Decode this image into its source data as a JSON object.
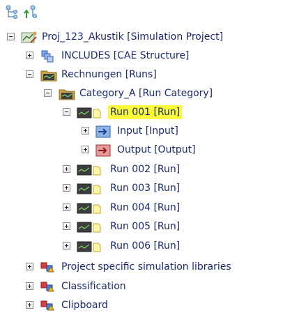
{
  "toolbar": {
    "icons": [
      "hierarchy-icon",
      "hierarchy-up-icon"
    ]
  },
  "colors": {
    "selection": "#fbfb3a",
    "text": "#1a2a73"
  },
  "tree": {
    "project": {
      "label": "Proj_123_Akustik [Simulation Project]",
      "expanded": true
    },
    "includes": {
      "label": "INCLUDES [CAE Structure]",
      "expanded": false
    },
    "rechnungen": {
      "label": "Rechnungen [Runs]",
      "expanded": true
    },
    "category_a": {
      "label": "Category_A [Run Category]",
      "expanded": true
    },
    "run001": {
      "label": "Run 001 [Run]",
      "expanded": true,
      "selected": true
    },
    "input": {
      "label": "Input [Input]",
      "expanded": false
    },
    "output": {
      "label": "Output [Output]",
      "expanded": false
    },
    "run002": {
      "label": "Run 002 [Run]",
      "expanded": false
    },
    "run003": {
      "label": "Run 003 [Run]",
      "expanded": false
    },
    "run004": {
      "label": "Run 004 [Run]",
      "expanded": false
    },
    "run005": {
      "label": "Run 005 [Run]",
      "expanded": false
    },
    "run006": {
      "label": "Run 006 [Run]",
      "expanded": false
    },
    "libraries": {
      "label": "Project specific simulation libraries",
      "expanded": false
    },
    "classification": {
      "label": "Classification",
      "expanded": false
    },
    "clipboard": {
      "label": "Clipboard",
      "expanded": false
    }
  }
}
